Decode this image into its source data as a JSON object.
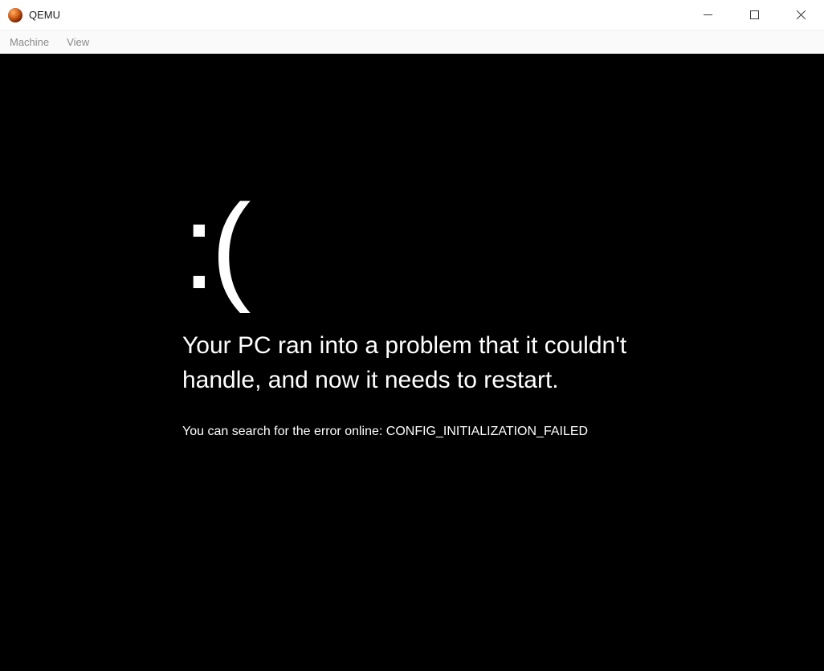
{
  "window": {
    "title": "QEMU",
    "controls": {
      "minimize": "minimize",
      "maximize": "maximize",
      "close": "close"
    }
  },
  "menubar": {
    "items": [
      {
        "label": "Machine"
      },
      {
        "label": "View"
      }
    ]
  },
  "crash": {
    "face": ":(",
    "message": "Your PC ran into a problem that it couldn't handle, and now it needs to restart.",
    "detail": "You can search for the error online: CONFIG_INITIALIZATION_FAILED"
  }
}
